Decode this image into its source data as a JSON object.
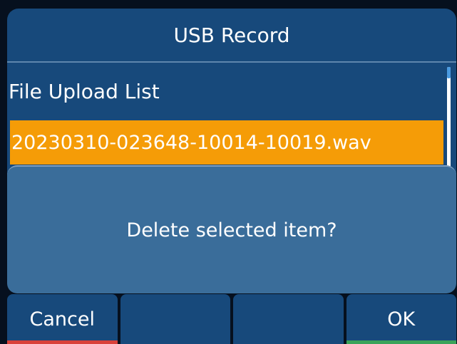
{
  "title": "USB Record",
  "list": {
    "header": "File Upload List",
    "selected_item": "20230310-023648-10014-10019.wav"
  },
  "dialog": {
    "message": "Delete selected item?"
  },
  "softkeys": [
    {
      "label": "Cancel",
      "bar_color": "#d9413a"
    },
    {
      "label": ""
    },
    {
      "label": ""
    },
    {
      "label": "OK",
      "bar_color": "#3aa35a"
    }
  ],
  "colors": {
    "title_bg": "#17497b",
    "dialog_bg": "#3a6d9a",
    "selection": "#f59c07",
    "text": "#ffffff"
  }
}
